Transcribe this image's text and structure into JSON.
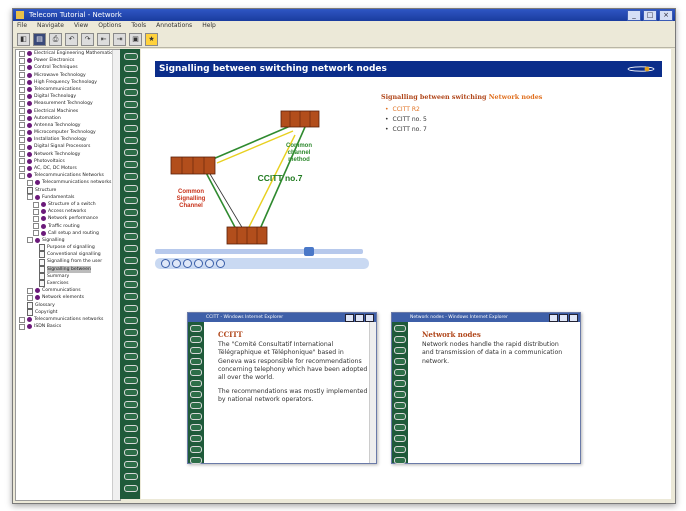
{
  "window": {
    "title": "Telecom Tutorial - Network",
    "controls": [
      "_",
      "□",
      "×"
    ]
  },
  "menu": [
    "File",
    "Navigate",
    "View",
    "Options",
    "Tools",
    "Annotations",
    "Help"
  ],
  "toolbar": [
    "◧",
    "▤",
    "⎙",
    "↶",
    "↷",
    "⇤",
    "⇥",
    "▣",
    "★"
  ],
  "tree": {
    "items": [
      {
        "label": "Electrical Engineering Mathematics",
        "kind": "book"
      },
      {
        "label": "Power Electronics",
        "kind": "book"
      },
      {
        "label": "Control Techniques",
        "kind": "book"
      },
      {
        "label": "Microwave Technology",
        "kind": "book"
      },
      {
        "label": "High Frequency Technology",
        "kind": "book"
      },
      {
        "label": "Telecommunications",
        "kind": "book"
      },
      {
        "label": "Digital Technology",
        "kind": "book"
      },
      {
        "label": "Measurement Technology",
        "kind": "book"
      },
      {
        "label": "Electrical Machines",
        "kind": "book"
      },
      {
        "label": "Automation",
        "kind": "book"
      },
      {
        "label": "Antenna Technology",
        "kind": "book"
      },
      {
        "label": "Microcomputer Technology",
        "kind": "book"
      },
      {
        "label": "Installation Technology",
        "kind": "book"
      },
      {
        "label": "Digital Signal Processors",
        "kind": "book"
      },
      {
        "label": "Network Technology",
        "kind": "book"
      },
      {
        "label": "Photovoltaics",
        "kind": "book"
      },
      {
        "label": "AC, DC, DC Motors",
        "kind": "book"
      },
      {
        "label": "Telecommunications Networks",
        "kind": "book"
      },
      {
        "label": "Telecommunications networks",
        "kind": "open"
      },
      {
        "label": "Structure",
        "kind": "doc"
      },
      {
        "label": "Fundamentals",
        "kind": "open"
      },
      {
        "label": "Structure of a switch",
        "kind": "book"
      },
      {
        "label": "Access networks",
        "kind": "book"
      },
      {
        "label": "Network performance",
        "kind": "book"
      },
      {
        "label": "Traffic routing",
        "kind": "book"
      },
      {
        "label": "Call setup and routing",
        "kind": "book"
      },
      {
        "label": "Signalling",
        "kind": "open"
      },
      {
        "label": "Purpose of signalling",
        "kind": "doc"
      },
      {
        "label": "Conventional signalling",
        "kind": "doc"
      },
      {
        "label": "Signalling from the user",
        "kind": "doc"
      },
      {
        "label": "Signalling between",
        "kind": "doc",
        "selected": true
      },
      {
        "label": "Summary",
        "kind": "doc"
      },
      {
        "label": "Exercises",
        "kind": "doc"
      },
      {
        "label": "Communications",
        "kind": "book"
      },
      {
        "label": "Network elements",
        "kind": "book"
      },
      {
        "label": "Glossary",
        "kind": "doc"
      },
      {
        "label": "Copyright",
        "kind": "doc"
      },
      {
        "label": "Telecommunications networks",
        "kind": "book"
      },
      {
        "label": "ISDN Basics",
        "kind": "book"
      }
    ]
  },
  "content": {
    "header": "Signalling between switching network nodes",
    "diagram": {
      "label_common_channel": [
        "Common",
        "channel",
        "method"
      ],
      "label_ccitt": "CCITT no.7",
      "label_common_signalling": [
        "Common",
        "Signalling",
        "Channel"
      ]
    },
    "video": {
      "progress": 0.75
    },
    "side": {
      "title_prefix": "Signalling between switching",
      "title_link": "Network nodes",
      "items": [
        {
          "label": "CCITT R2",
          "current": true
        },
        {
          "label": "CCITT no. 5"
        },
        {
          "label": "CCITT no. 7"
        }
      ]
    }
  },
  "popups": [
    {
      "bar_title": "CCITT - Windows Internet Explorer",
      "title": "CCITT",
      "paragraphs": [
        "The \"Comité Consultatif International Télégraphique et Téléphonique\" based in Geneva was responsible for recommendations concerning telephony which have been adopted all over the world.",
        "The recommendations was mostly implemented by national network operators."
      ]
    },
    {
      "bar_title": "Network nodes - Windows Internet Explorer",
      "title": "Network nodes",
      "paragraphs": [
        "Network nodes handle the rapid distribution and transmission of data in a communication network."
      ]
    }
  ],
  "colors": {
    "header_bg": "#0b2d8a",
    "spiral": "#1f5a3a",
    "link_orange": "#e07020",
    "title_red": "#b0461a",
    "green_line": "#2f8a2f",
    "yellow_line": "#e8d020",
    "cabinet": "#b24e1c"
  }
}
